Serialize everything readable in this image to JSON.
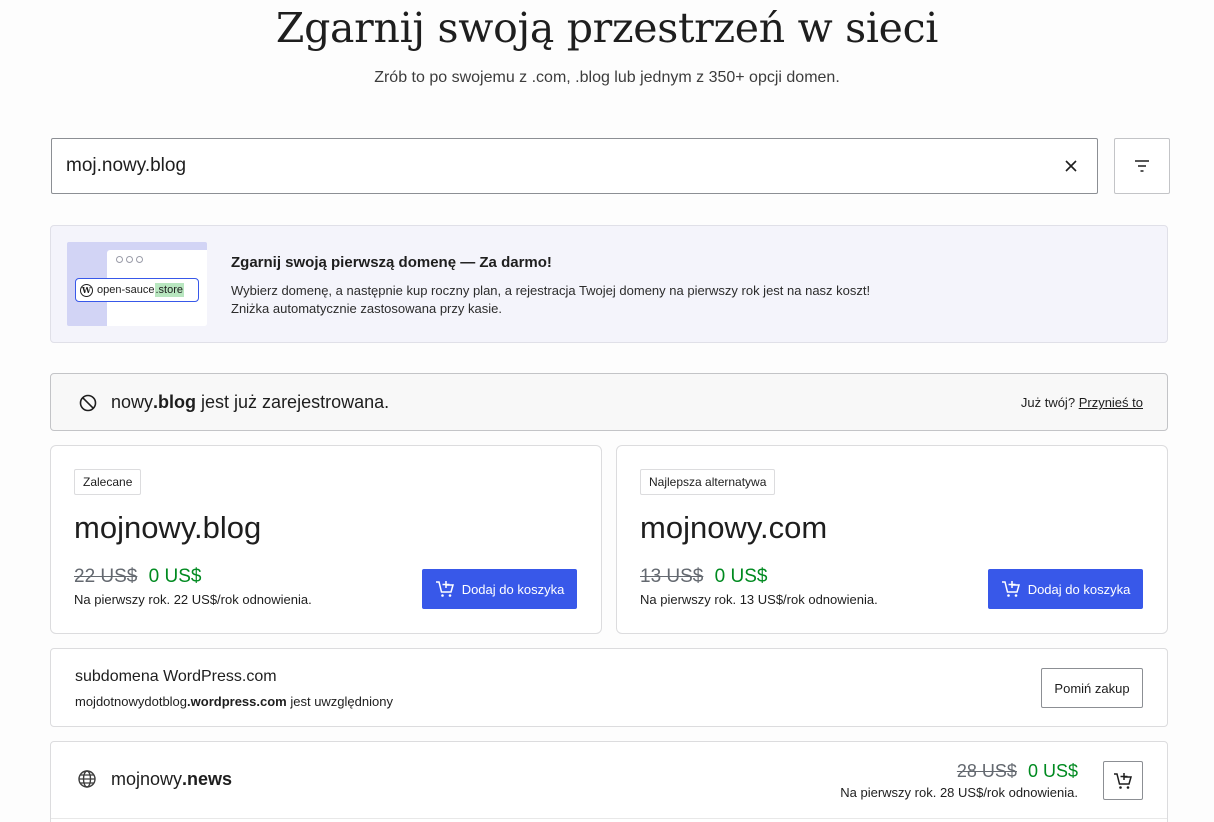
{
  "hero": {
    "title": "Zgarnij swoją przestrzeń w sieci",
    "subtitle": "Zrób to po swojemu z .com, .blog lub jednym z 350+ opcji domen."
  },
  "search": {
    "value": "moj.nowy.blog",
    "clear_icon": "close-icon",
    "filter_icon": "filter-icon"
  },
  "promo": {
    "illustration_name": "open-sauce",
    "illustration_tld": ".store",
    "title": "Zgarnij swoją pierwszą domenę — Za darmo!",
    "line1": "Wybierz domenę, a następnie kup roczny plan, a rejestracja Twojej domeny na pierwszy rok jest na nasz koszt!",
    "line2": "Zniżka automatycznie zastosowana przy kasie."
  },
  "taken": {
    "name": "nowy",
    "tld": ".blog",
    "suffix": " jest już zarejestrowana.",
    "question": "Już twój?",
    "transfer_link": "Przynieś to"
  },
  "cards": [
    {
      "badge": "Zalecane",
      "domain": "mojnowy.blog",
      "old_price": "22 US$",
      "new_price": "0 US$",
      "renewal": "Na pierwszy rok. 22 US$/rok odnowienia.",
      "button": "Dodaj do koszyka"
    },
    {
      "badge": "Najlepsza alternatywa",
      "domain": "mojnowy.com",
      "old_price": "13 US$",
      "new_price": "0 US$",
      "renewal": "Na pierwszy rok. 13 US$/rok odnowienia.",
      "button": "Dodaj do koszyka"
    }
  ],
  "subdomain": {
    "title": "subdomena WordPress.com",
    "prefix": "mojdotnowydotblog",
    "host": ".wordpress.com",
    "suffix": " jest uwzględniony",
    "skip_button": "Pomiń zakup"
  },
  "results": [
    {
      "name": "mojnowy",
      "tld": ".news",
      "old_price": "28 US$",
      "new_price": "0 US$",
      "renewal": "Na pierwszy rok. 28 US$/rok odnowienia."
    }
  ],
  "colors": {
    "accent": "#3858e9",
    "price_green": "#008a20",
    "promo_bg": "#f4f4fb"
  }
}
